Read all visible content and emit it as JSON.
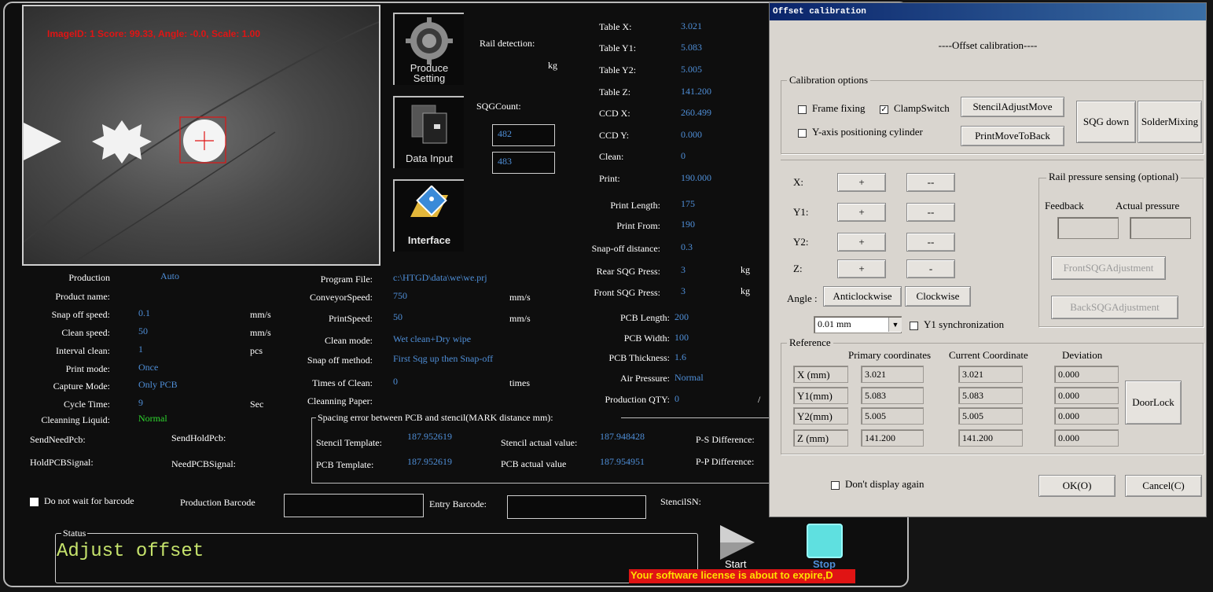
{
  "camera": {
    "overlay": "ImageID: 1 Score: 99.33, Angle: -0.0, Scale: 1.00"
  },
  "side_buttons": {
    "produce": "Produce Setting",
    "data_input": "Data Input",
    "interface": "Interface"
  },
  "rail": {
    "label": "Rail detection:",
    "unit": "kg"
  },
  "sqg": {
    "label": "SQGCount:",
    "value1": "482",
    "value2": "483"
  },
  "table_pos": [
    {
      "label": "Table X:",
      "value": "3.021"
    },
    {
      "label": "Table Y1:",
      "value": "5.083"
    },
    {
      "label": "Table Y2:",
      "value": "5.005"
    },
    {
      "label": "Table Z:",
      "value": "141.200"
    },
    {
      "label": "CCD X:",
      "value": "260.499"
    },
    {
      "label": "CCD Y:",
      "value": "0.000"
    },
    {
      "label": "Clean:",
      "value": "0"
    },
    {
      "label": "Print:",
      "value": "190.000"
    }
  ],
  "print_params": [
    {
      "label": "Print Length:",
      "value": "175"
    },
    {
      "label": "Print From:",
      "value": "190"
    },
    {
      "label": "Snap-off distance:",
      "value": "0.3"
    },
    {
      "label": "Rear SQG Press:",
      "value": "3",
      "unit": "kg"
    },
    {
      "label": "Front SQG Press:",
      "value": "3",
      "unit": "kg"
    }
  ],
  "pcb": [
    {
      "label": "PCB Length:",
      "value": "200"
    },
    {
      "label": "PCB Width:",
      "value": "100"
    },
    {
      "label": "PCB Thickness:",
      "value": "1.6"
    },
    {
      "label": "Air Pressure:",
      "value": "Normal"
    },
    {
      "label": "Production QTY:",
      "value": "0",
      "suffix": "/"
    }
  ],
  "left_params": [
    {
      "label": "Production",
      "value": "Auto",
      "unit": ""
    },
    {
      "label": "Product name:",
      "value": "",
      "unit": ""
    },
    {
      "label": "Snap off speed:",
      "value": "0.1",
      "unit": "mm/s"
    },
    {
      "label": "Clean speed:",
      "value": "50",
      "unit": "mm/s"
    },
    {
      "label": "Interval clean:",
      "value": "1",
      "unit": "pcs"
    },
    {
      "label": "Print mode:",
      "value": "Once",
      "unit": ""
    },
    {
      "label": "Capture Mode:",
      "value": "Only PCB",
      "unit": ""
    },
    {
      "label": "Cycle Time:",
      "value": "9",
      "unit": "Sec"
    },
    {
      "label": "Cleanning Liquid:",
      "value": "Normal",
      "unit": ""
    }
  ],
  "signals": {
    "send_need": "SendNeedPcb:",
    "send_hold": "SendHoldPcb:",
    "hold_signal": "HoldPCBSignal:",
    "need_signal": "NeedPCBSignal:"
  },
  "mid_params": [
    {
      "label": "Program File:",
      "value": "c:\\HTGD\\data\\we\\we.prj",
      "unit": ""
    },
    {
      "label": "ConveyorSpeed:",
      "value": "750",
      "unit": "mm/s"
    },
    {
      "label": "PrintSpeed:",
      "value": "50",
      "unit": "mm/s"
    },
    {
      "label": "Clean mode:",
      "value": "Wet clean+Dry wipe",
      "unit": ""
    },
    {
      "label": "Snap off method:",
      "value": "First Sqg up then Snap-off",
      "unit": ""
    },
    {
      "label": "Times of Clean:",
      "value": "0",
      "unit": "times"
    },
    {
      "label": "Cleanning Paper:",
      "value": "",
      "unit": ""
    }
  ],
  "spacing": {
    "title": "Spacing error between PCB and stencil(MARK distance mm):",
    "stencil_template_label": "Stencil Template:",
    "stencil_template_value": "187.952619",
    "stencil_actual_label": "Stencil actual value:",
    "stencil_actual_value": "187.948428",
    "ps_label": "P-S Difference:",
    "pcb_template_label": "PCB Template:",
    "pcb_template_value": "187.952619",
    "pcb_actual_label": "PCB actual value",
    "pcb_actual_value": "187.954951",
    "pp_label": "P-P Difference:"
  },
  "barcode": {
    "no_wait": "Do not wait for barcode",
    "production": "Production Barcode",
    "entry": "Entry Barcode:",
    "stencil_sn": "StencilSN:"
  },
  "status": {
    "label": "Status",
    "text": "Adjust offset"
  },
  "controls": {
    "start": "Start",
    "stop": "Stop"
  },
  "license": "Your software license is about to expire,D",
  "dialog": {
    "title": "Offset calibration",
    "header": "----Offset calibration----",
    "calib_group": "Calibration options",
    "frame_fixing": "Frame fixing",
    "clamp_switch": "ClampSwitch",
    "y_axis_cyl": "Y-axis positioning cylinder",
    "stencil_adjust": "StencilAdjustMove",
    "print_move_back": "PrintMoveToBack",
    "sqg_down": "SQG down",
    "solder_mixing": "SolderMixing",
    "axes": [
      {
        "label": "X:",
        "plus": "+",
        "minus": "--"
      },
      {
        "label": "Y1:",
        "plus": "+",
        "minus": "--"
      },
      {
        "label": "Y2:",
        "plus": "+",
        "minus": "--"
      },
      {
        "label": "Z:",
        "plus": "+",
        "minus": "-"
      }
    ],
    "angle_label": "Angle :",
    "anticlockwise": "Anticlockwise",
    "clockwise": "Clockwise",
    "step_value": "0.01 mm",
    "y1_sync": "Y1 synchronization",
    "rail_group": "Rail pressure sensing (optional)",
    "feedback": "Feedback",
    "actual_pressure": "Actual pressure",
    "front_sqg": "FrontSQGAdjustment",
    "back_sqg": "BackSQGAdjustment",
    "ref_group": "Reference",
    "col_primary": "Primary coordinates",
    "col_current": "Current Coordinate",
    "col_deviation": "Deviation",
    "ref_rows": [
      {
        "label": "X  (mm)",
        "primary": "3.021",
        "current": "3.021",
        "deviation": "0.000"
      },
      {
        "label": "Y1(mm)",
        "primary": "5.083",
        "current": "5.083",
        "deviation": "0.000"
      },
      {
        "label": "Y2(mm)",
        "primary": "5.005",
        "current": "5.005",
        "deviation": "0.000"
      },
      {
        "label": "Z  (mm)",
        "primary": "141.200",
        "current": "141.200",
        "deviation": "0.000"
      }
    ],
    "door_lock": "DoorLock",
    "dont_display": "Don't display again",
    "ok": "OK(O)",
    "cancel": "Cancel(C)"
  },
  "colors": {
    "value_blue": "#4f8fd8",
    "status_green": "#c6e36c",
    "license_red": "#e01414",
    "stop_cyan": "#5fe0e0"
  }
}
